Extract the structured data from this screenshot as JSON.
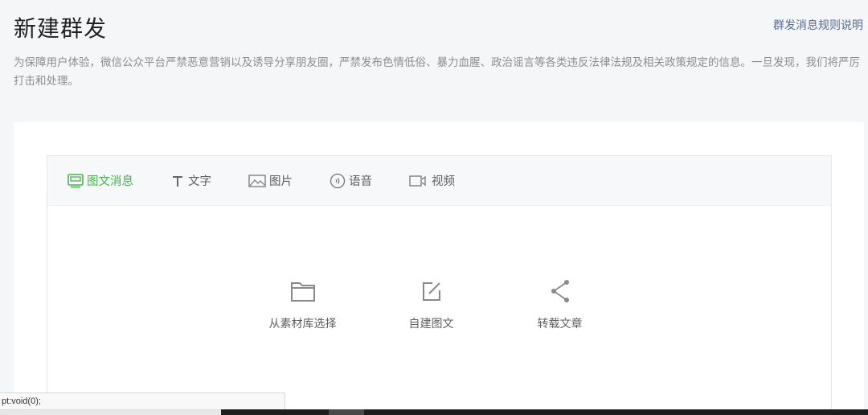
{
  "header": {
    "title": "新建群发",
    "rules_link": "群发消息规则说明"
  },
  "notice": "为保障用户体验，微信公众平台严禁恶意营销以及诱导分享朋友圈，严禁发布色情低俗、暴力血腥、政治谣言等各类违反法律法规及相关政策规定的信息。一旦发现，我们将严厉打击和处理。",
  "tabs": [
    {
      "label": "图文消息",
      "icon": "news-icon",
      "active": true
    },
    {
      "label": "文字",
      "icon": "text-icon",
      "active": false
    },
    {
      "label": "图片",
      "icon": "image-icon",
      "active": false
    },
    {
      "label": "语音",
      "icon": "voice-icon",
      "active": false
    },
    {
      "label": "视频",
      "icon": "video-icon",
      "active": false
    }
  ],
  "actions": [
    {
      "label": "从素材库选择",
      "icon": "folder-icon"
    },
    {
      "label": "自建图文",
      "icon": "edit-icon"
    },
    {
      "label": "转载文章",
      "icon": "share-icon"
    }
  ],
  "status_bar": {
    "text": "pt:void(0);"
  },
  "colors": {
    "accent": "#44b549",
    "link": "#576b95",
    "background": "#f5f6f8"
  }
}
